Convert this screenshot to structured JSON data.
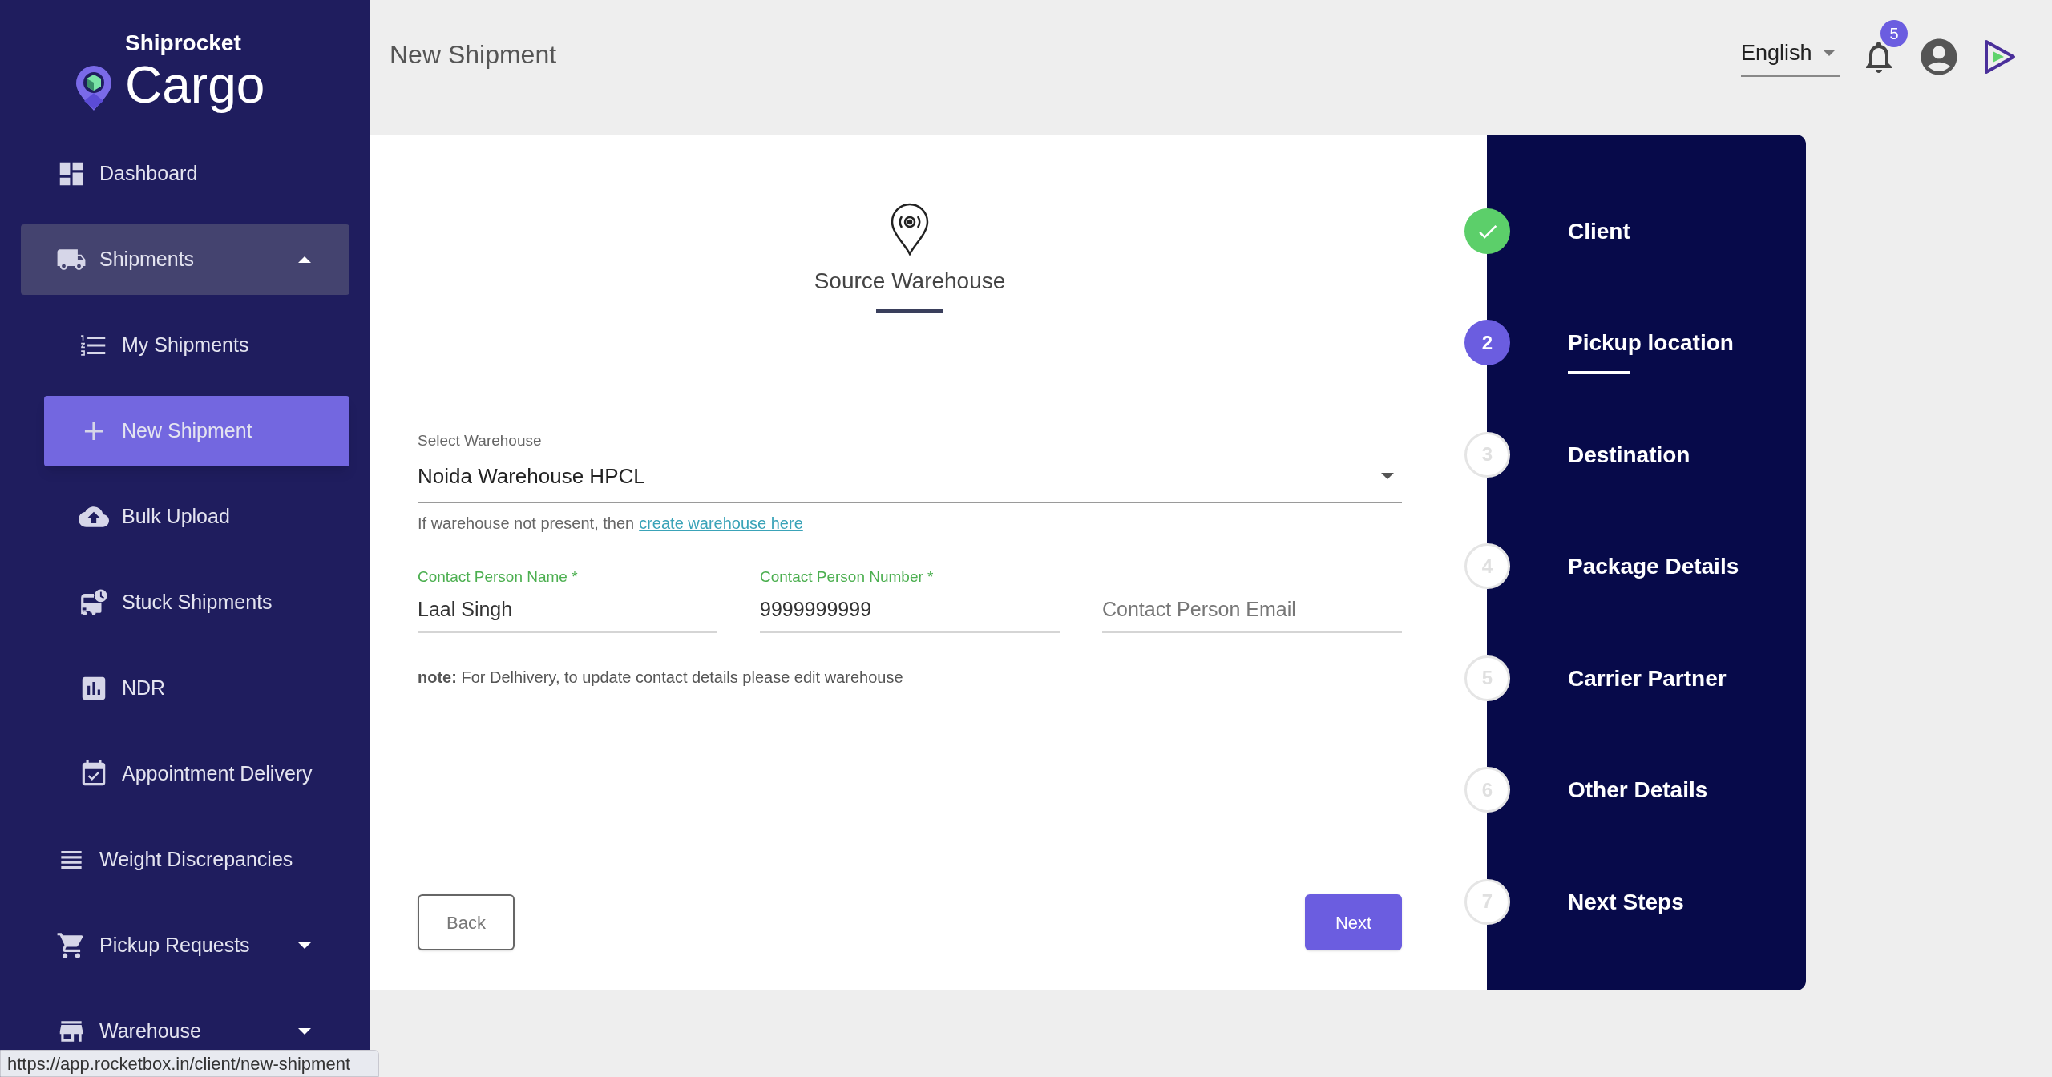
{
  "header": {
    "title": "New Shipment",
    "language": "English",
    "notification_count": "5"
  },
  "brand": {
    "top": "Shiprocket",
    "name": "Cargo"
  },
  "sidebar": {
    "items": [
      {
        "label": "Dashboard",
        "selected": false
      },
      {
        "label": "Shipments",
        "expanded": true,
        "selected": false,
        "children": [
          {
            "label": "My Shipments",
            "selected": false
          },
          {
            "label": "New Shipment",
            "selected": true
          },
          {
            "label": "Bulk Upload",
            "selected": false
          },
          {
            "label": "Stuck Shipments",
            "selected": false
          },
          {
            "label": "NDR",
            "selected": false
          },
          {
            "label": "Appointment Delivery",
            "selected": false
          }
        ]
      },
      {
        "label": "Weight Discrepancies",
        "selected": false
      },
      {
        "label": "Pickup Requests",
        "expanded": false,
        "selected": false
      },
      {
        "label": "Warehouse",
        "expanded": false,
        "selected": false
      }
    ]
  },
  "form": {
    "title": "Source Warehouse",
    "warehouse": {
      "label": "Select Warehouse",
      "value": "Noida Warehouse HPCL"
    },
    "helper": {
      "text": "If warehouse not present, then",
      "link": "create warehouse here"
    },
    "contact_fields": [
      {
        "label": "Contact Person Name *",
        "value": "Laal Singh"
      },
      {
        "label": "Contact Person Number *",
        "value": "9999999999"
      },
      {
        "placeholder": "Contact Person Email"
      }
    ],
    "note": "**note:** For Delhivery, to update contact details please edit warehouse",
    "buttons": [
      {
        "label": "Back",
        "kind": "outline"
      },
      {
        "label": "Next",
        "kind": "primary"
      }
    ]
  },
  "stepper": {
    "steps": [
      {
        "label": "Client",
        "completed": true,
        "selected": false
      },
      {
        "label": "Pickup location",
        "number": "2",
        "completed": false,
        "selected": true
      },
      {
        "label": "Destination",
        "number": "3",
        "completed": false,
        "selected": false
      },
      {
        "label": "Package Details",
        "number": "4",
        "completed": false,
        "selected": false
      },
      {
        "label": "Carrier Partner",
        "number": "5",
        "completed": false,
        "selected": false
      },
      {
        "label": "Other Details",
        "number": "6",
        "completed": false,
        "selected": false
      },
      {
        "label": "Next Steps",
        "number": "7",
        "completed": false,
        "selected": false
      }
    ]
  },
  "status_url": "https://app.rocketbox.in/client/new-shipment"
}
